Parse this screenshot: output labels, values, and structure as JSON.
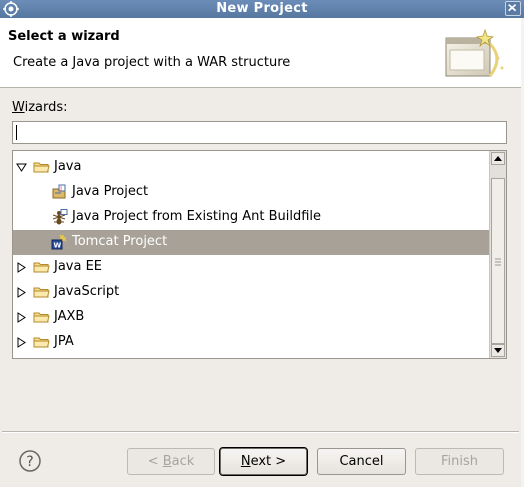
{
  "window": {
    "title": "New Project"
  },
  "header": {
    "title": "Select a wizard",
    "description": "Create a Java project with a WAR structure"
  },
  "filter": {
    "label_prefix": "",
    "label_mnemonic": "W",
    "label_rest": "izards:",
    "value": ""
  },
  "tree": {
    "items": [
      {
        "label": "Java",
        "expanded": true,
        "icon": "folder-icon"
      },
      {
        "label": "Java Project",
        "icon": "java-project-icon"
      },
      {
        "label": "Java Project from Existing Ant Buildfile",
        "icon": "ant-icon"
      },
      {
        "label": "Tomcat Project",
        "icon": "tomcat-icon",
        "selected": true
      },
      {
        "label": "Java EE",
        "expanded": false,
        "icon": "folder-icon"
      },
      {
        "label": "JavaScript",
        "expanded": false,
        "icon": "folder-icon"
      },
      {
        "label": "JAXB",
        "expanded": false,
        "icon": "folder-icon"
      },
      {
        "label": "JPA",
        "expanded": false,
        "icon": "folder-icon"
      }
    ]
  },
  "buttons": {
    "back_prefix": "< ",
    "back_mnemonic": "B",
    "back_rest": "ack",
    "next_mnemonic": "N",
    "next_rest": "ext >",
    "cancel": "Cancel",
    "finish": "Finish"
  },
  "colors": {
    "titlebar": "#6b8db8",
    "selection": "#a8a197",
    "dialog_bg": "#efebe7"
  }
}
